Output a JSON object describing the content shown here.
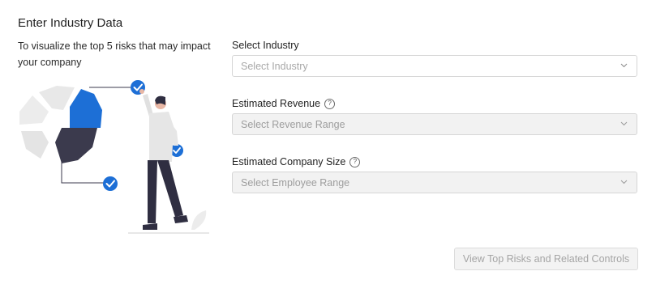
{
  "header": {
    "title": "Enter Industry Data",
    "intro": "To visualize the top 5 risks that may impact your company"
  },
  "form": {
    "industry": {
      "label": "Select Industry",
      "placeholder": "Select Industry"
    },
    "revenue": {
      "label": "Estimated Revenue",
      "placeholder": "Select Revenue Range",
      "help_icon": "question-circle-icon"
    },
    "company_size": {
      "label": "Estimated Company Size",
      "placeholder": "Select Employee Range",
      "help_icon": "question-circle-icon"
    },
    "submit_label": "View Top Risks and Related Controls"
  },
  "colors": {
    "accent": "#1d6fd6",
    "dark_segment": "#3b3a4d",
    "light_segment": "#e8e8e8",
    "disabled_bg": "#f2f2f2"
  },
  "icons": {
    "help": "?",
    "chevron": "chevron-down-icon",
    "check": "checkmark-icon"
  }
}
